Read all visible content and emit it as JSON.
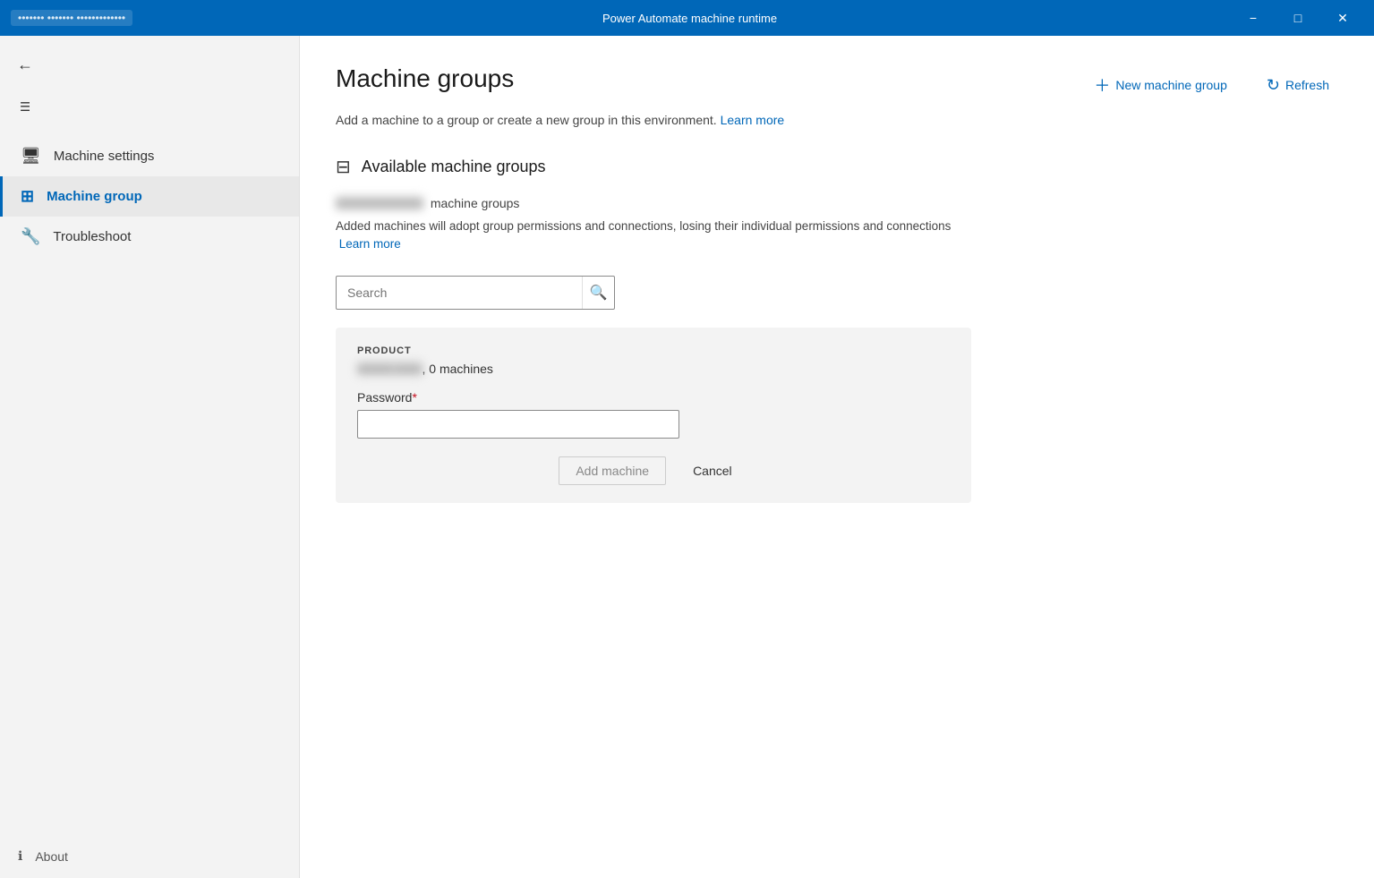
{
  "titlebar": {
    "title": "Power Automate machine runtime",
    "user_label": "••••••• ••••••• •••••••••••••",
    "minimize_label": "−",
    "maximize_label": "□",
    "close_label": "✕"
  },
  "sidebar": {
    "back_label": "←",
    "hamburger_label": "☰",
    "items": [
      {
        "id": "machine-settings",
        "label": "Machine settings",
        "icon": "🖥"
      },
      {
        "id": "machine-group",
        "label": "Machine group",
        "icon": "⊞",
        "active": true
      },
      {
        "id": "troubleshoot",
        "label": "Troubleshoot",
        "icon": "🔧"
      }
    ],
    "footer": {
      "icon": "ℹ",
      "label": "About"
    }
  },
  "main": {
    "page_title": "Machine groups",
    "subtitle_text": "Add a machine to a group or create a new group in this environment.",
    "subtitle_link_label": "Learn more",
    "new_machine_group_label": "New machine group",
    "refresh_label": "Refresh",
    "section_title": "Available machine groups",
    "group_count_prefix": "••••••••••••••••••••",
    "group_count_suffix": "machine groups",
    "group_description": "Added machines will adopt group permissions and connections, losing their individual permissions and connections",
    "learn_more_label": "Learn more",
    "search_placeholder": "Search",
    "card": {
      "product_label": "PRODUCT",
      "group_name": "•••••••• ••••••",
      "machines_count": ", 0 machines",
      "password_label": "Password",
      "required_mark": "*",
      "add_machine_label": "Add machine",
      "cancel_label": "Cancel"
    }
  }
}
